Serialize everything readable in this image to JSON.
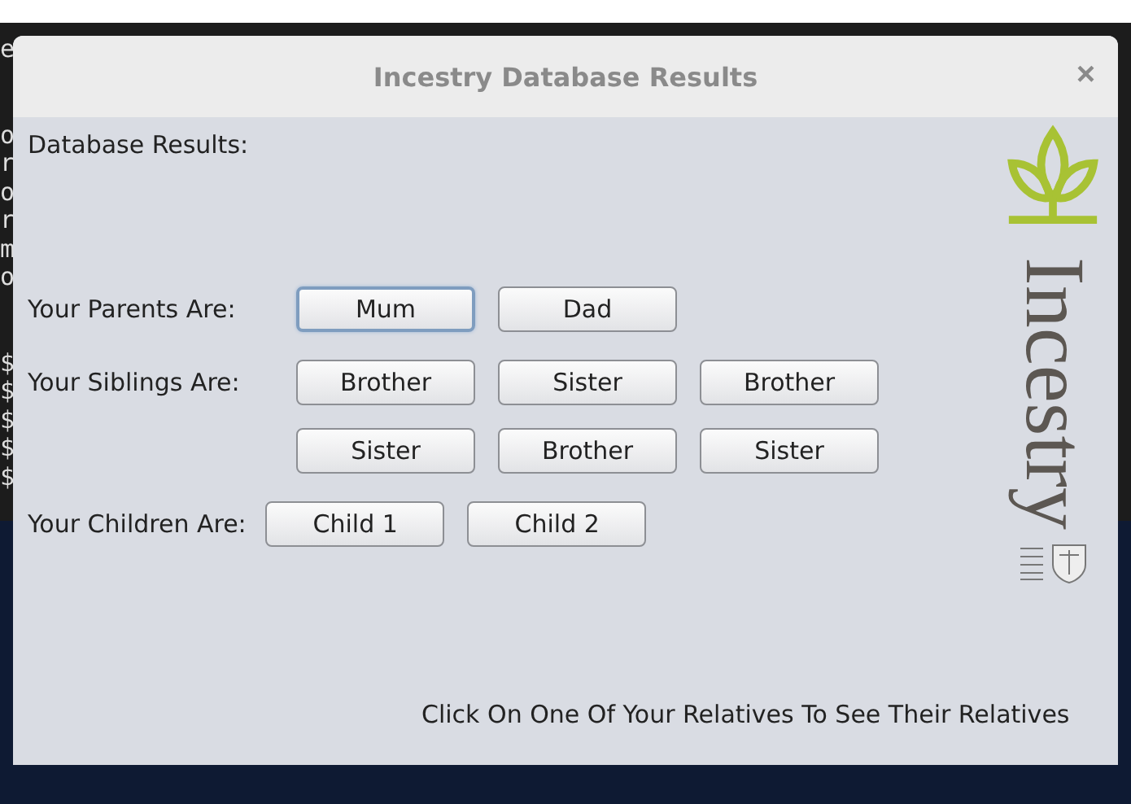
{
  "terminal": {
    "blocks": [
      [
        "e"
      ],
      [
        "o",
        "r",
        "o",
        "r",
        "m",
        "o"
      ],
      [
        "$",
        "$",
        "$",
        "$",
        "$"
      ]
    ]
  },
  "window": {
    "title": "Incestry Database Results",
    "close": "×"
  },
  "heading": "Database Results:",
  "groups": [
    {
      "label": "Your Parents Are:",
      "rows": [
        [
          {
            "label": "Mum",
            "selected": true
          },
          {
            "label": "Dad",
            "selected": false
          }
        ]
      ]
    },
    {
      "label": "Your Siblings Are:",
      "rows": [
        [
          {
            "label": "Brother",
            "selected": false
          },
          {
            "label": "Sister",
            "selected": false
          },
          {
            "label": "Brother",
            "selected": false
          }
        ],
        [
          {
            "label": "Sister",
            "selected": false
          },
          {
            "label": "Brother",
            "selected": false
          },
          {
            "label": "Sister",
            "selected": false
          }
        ]
      ]
    },
    {
      "label": "Your Children Are:",
      "rows": [
        [
          {
            "label": "Child 1",
            "selected": false
          },
          {
            "label": "Child 2",
            "selected": false
          }
        ]
      ]
    }
  ],
  "logo": {
    "text": "Incestry"
  },
  "hint": "Click On One Of Your Relatives To See Their Relatives"
}
